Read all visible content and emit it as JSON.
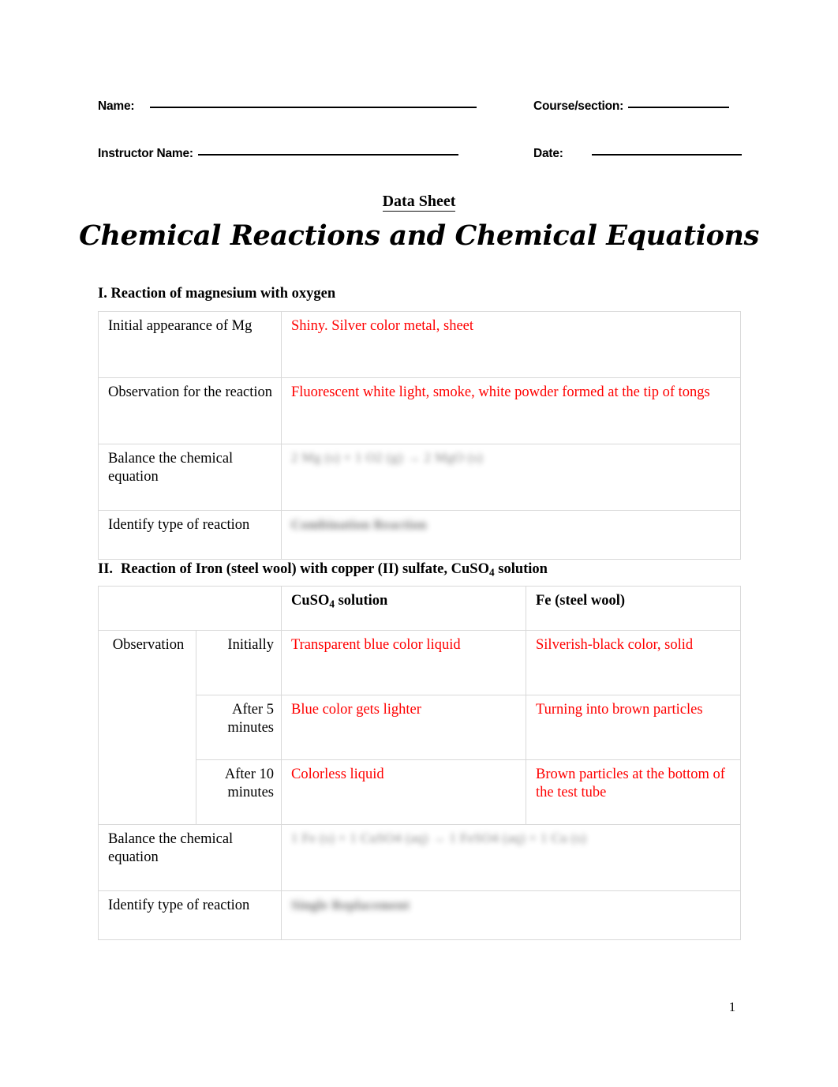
{
  "document": {
    "data_sheet_label": "Data Sheet",
    "title": "Chemical Reactions and Chemical Equations",
    "page_number": "1",
    "answer_color": "#FF0000",
    "border_color": "#D9D9D9"
  },
  "header": {
    "name_label": "Name:",
    "name_value": "",
    "course_label": "Course/section:",
    "course_value": "",
    "instructor_label": "Instructor Name:",
    "instructor_value": "",
    "date_label": "Date:",
    "date_value": ""
  },
  "sections": [
    {
      "number": "I.",
      "heading": "I. Reaction of magnesium with oxygen",
      "rows": [
        {
          "label": "Initial appearance of Mg",
          "answer": "Shiny. Silver color metal, sheet",
          "style": "answer"
        },
        {
          "label": "Observation for the reaction",
          "answer": "Fluorescent white light, smoke, white powder formed at the tip of tongs",
          "style": "answer"
        },
        {
          "label": "Balance the chemical equation",
          "answer_blurred_parts": [
            "2",
            "Mg (s)",
            "+",
            "1",
            "O",
            "2",
            "(g)",
            "2",
            "MgO (s)"
          ],
          "answer_blurred": "2  Mg (s)   +   1  O2 (g)   →   2  MgO (s)",
          "style": "blurred-equation"
        },
        {
          "label": "Identify type of reaction",
          "answer_blurred": "Combination Reaction",
          "style": "blurred-text"
        }
      ]
    },
    {
      "number": "II.",
      "heading_prefix": "II.",
      "heading_rest": "Reaction of Iron (steel wool) with copper (II) sulfate, CuSO",
      "heading_sub": "4",
      "heading_suffix": " solution",
      "column_headers": {
        "blank": "",
        "col1": "CuSO",
        "col1_sub": "4",
        "col1_suffix": " solution",
        "col2": "Fe (steel wool)"
      },
      "observation_label": "Observation",
      "observation_rows": [
        {
          "time": "Initially",
          "cuso4": "Transparent blue color liquid",
          "fe": "Silverish-black color, solid"
        },
        {
          "time": "After 5 minutes",
          "cuso4": "Blue color gets lighter",
          "fe": "Turning into brown particles"
        },
        {
          "time": "After 10 minutes",
          "cuso4": "Colorless liquid",
          "fe": "Brown particles at the bottom of the test tube"
        }
      ],
      "balance_label": "Balance the chemical equation",
      "balance_answer_blurred": "1  Fe (s)   +   1  CuSO4 (aq)   →   1  FeSO4 (aq)   +   1  Cu (s)",
      "identify_label": "Identify type of reaction",
      "identify_answer_blurred": "Single Replacement"
    }
  ]
}
